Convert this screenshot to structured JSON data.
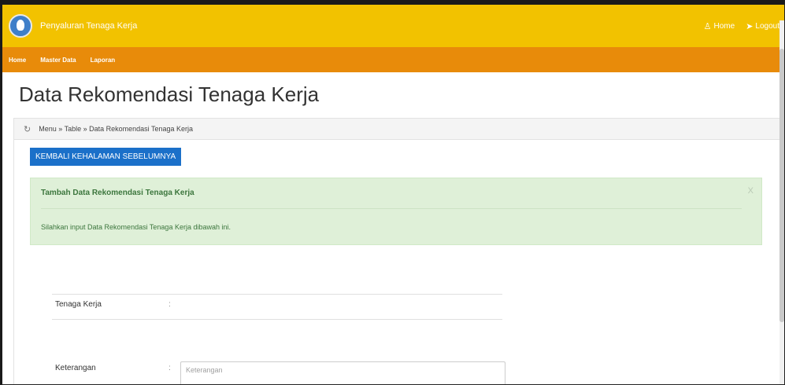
{
  "header": {
    "app_title": "Penyaluran Tenaga Kerja",
    "home_label": "Home",
    "logout_label": "Logout",
    "brand_color": "#f2c200",
    "nav_color": "#e88b0a"
  },
  "nav": {
    "items": [
      {
        "label": "Home"
      },
      {
        "label": "Master Data"
      },
      {
        "label": "Laporan"
      }
    ]
  },
  "page": {
    "title": "Data Rekomendasi Tenaga Kerja",
    "breadcrumb": "Menu » Table » Data Rekomendasi Tenaga Kerja",
    "back_button": "KEMBALI KEHALAMAN SEBELUMNYA"
  },
  "alert": {
    "title": "Tambah Data Rekomendasi Tenaga Kerja",
    "close": "X",
    "body": "Silahkan input Data Rekomendasi Tenaga Kerja dibawah ini."
  },
  "form": {
    "tenaga_label": "Tenaga Kerja",
    "keterangan_label": "Keterangan",
    "colon": ":",
    "keterangan_placeholder": "Keterangan"
  }
}
